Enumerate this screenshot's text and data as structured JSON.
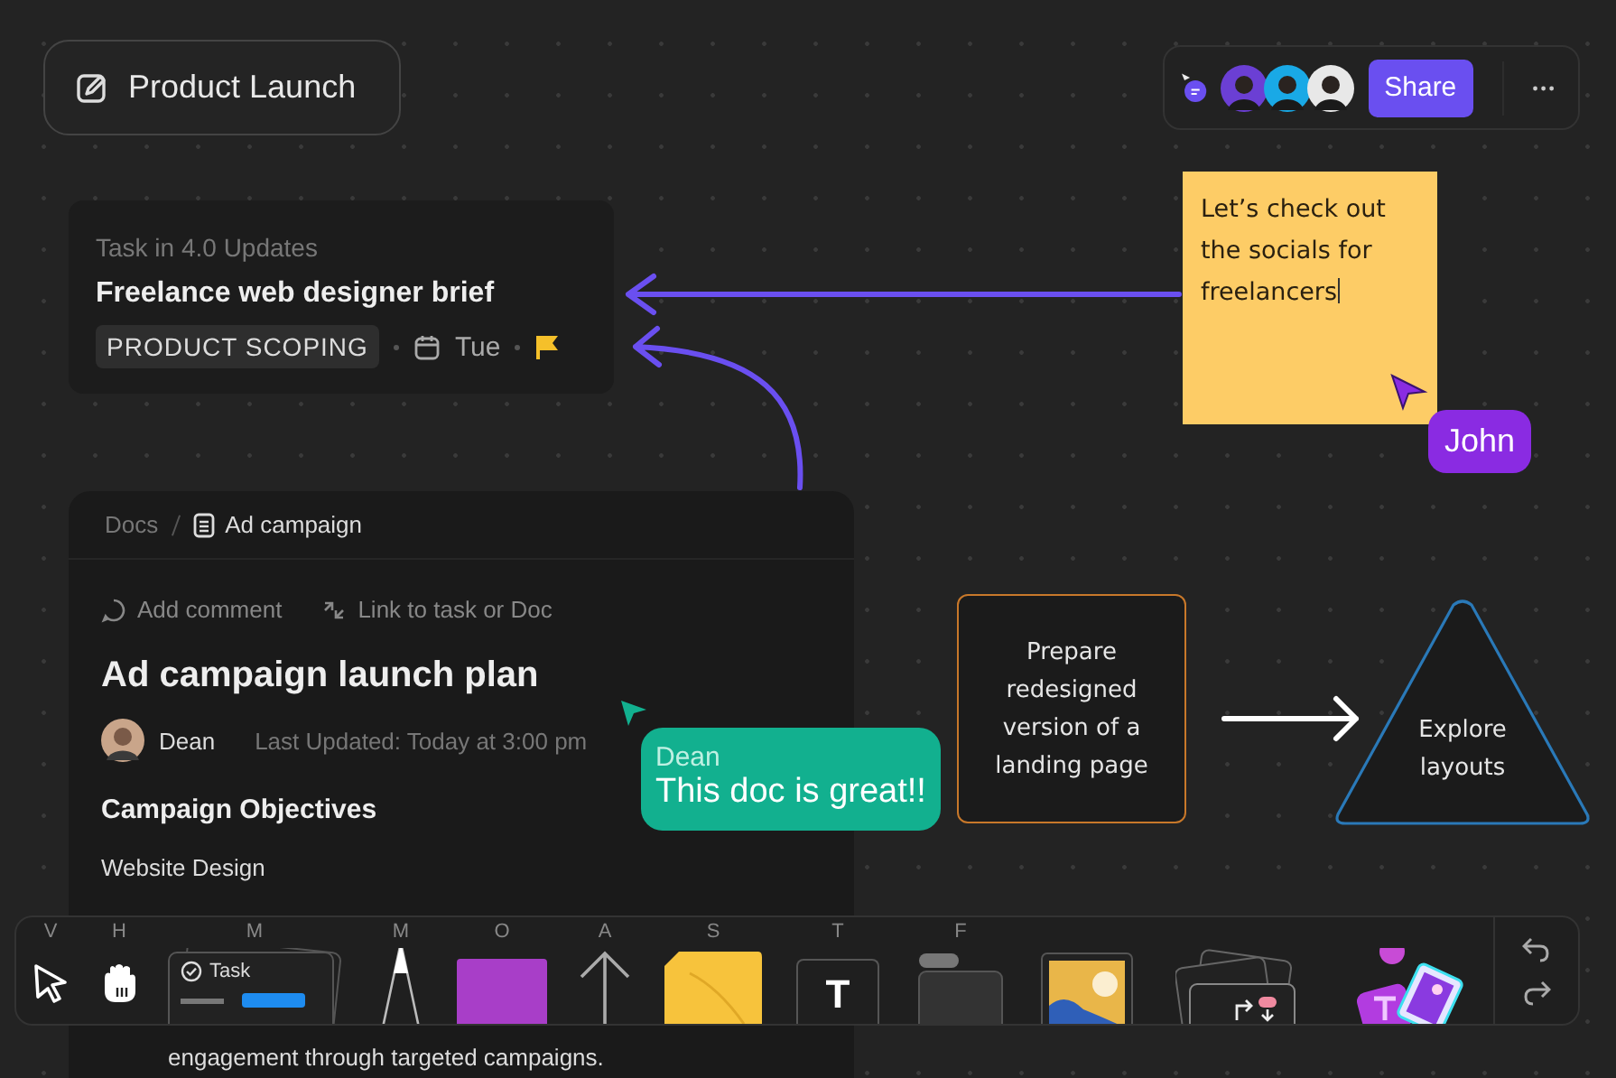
{
  "board": {
    "title": "Product Launch"
  },
  "collab_bar": {
    "avatars": [
      {
        "color": "#6b3fd4"
      },
      {
        "color": "#19a9e6"
      },
      {
        "color": "#e8e8e8"
      }
    ],
    "share": "Share"
  },
  "task_card": {
    "context": "Task in 4.0 Updates",
    "title": "Freelance web designer brief",
    "tag": "PRODUCT SCOPING",
    "due": "Tue"
  },
  "sticky_note": {
    "text": "Let’s check out the socials for freelancers"
  },
  "cursors": [
    {
      "name": "John",
      "color": "#8a2be2"
    },
    {
      "name": "Dean",
      "message": "This doc is great!!",
      "color": "#12b08f"
    }
  ],
  "doc": {
    "breadcrumb": [
      "Docs",
      "Ad campaign"
    ],
    "actions": [
      "Add comment",
      "Link to task or Doc"
    ],
    "title": "Ad campaign launch plan",
    "author": "Dean",
    "updated": "Last Updated: Today at 3:00 pm",
    "heading": "Campaign Objectives",
    "subheading": "Website Design",
    "body": "engagement through targeted campaigns."
  },
  "shapes": [
    {
      "kind": "rectangle",
      "text": "Prepare redesigned version of a landing page"
    },
    {
      "kind": "triangle",
      "text": "Explore layouts"
    }
  ],
  "toolbar": [
    {
      "kind": "select",
      "key": "V"
    },
    {
      "kind": "hand",
      "key": "H"
    },
    {
      "kind": "task",
      "key": "M",
      "label": "Task"
    },
    {
      "kind": "pen",
      "key": "M"
    },
    {
      "kind": "shape",
      "key": "O"
    },
    {
      "kind": "arrow",
      "key": "A"
    },
    {
      "kind": "sticky",
      "key": "S"
    },
    {
      "kind": "text",
      "key": "T",
      "glyph": "T"
    },
    {
      "kind": "frame",
      "key": "F"
    },
    {
      "kind": "image"
    },
    {
      "kind": "flow"
    },
    {
      "kind": "ai"
    }
  ]
}
